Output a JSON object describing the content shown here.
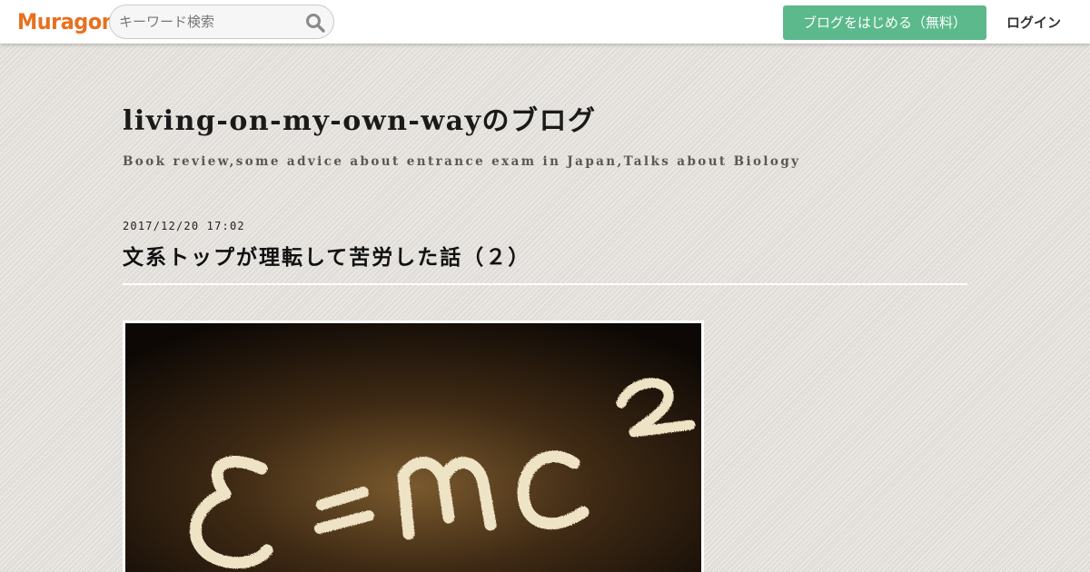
{
  "header": {
    "logo_text": "Muragon",
    "search": {
      "placeholder": "キーワード検索",
      "value": "",
      "icon": "search-icon"
    },
    "start_blog_label": "ブログをはじめる（無料）",
    "login_label": "ログイン"
  },
  "blog": {
    "title": "living-on-my-own-wayのブログ",
    "description": "Book review,some advice about entrance exam in Japan,Talks about Biology"
  },
  "post": {
    "date": "2017/12/20 17:02",
    "title": "文系トップが理転して苦労した話（２）",
    "image": {
      "formula_text": "E=mc",
      "exponent": "2"
    }
  },
  "colors": {
    "brand_orange": "#e8701e",
    "cta_green": "#5bb98c",
    "background": "#e4e1dc",
    "chalk": "#efe3c6"
  }
}
